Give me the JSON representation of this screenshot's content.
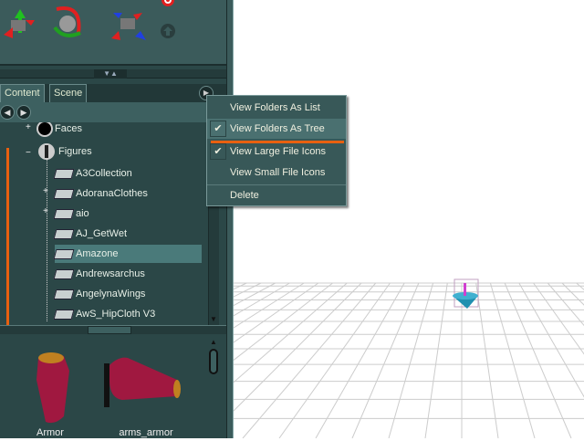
{
  "tabs": [
    {
      "label": "Content",
      "active": true
    },
    {
      "label": "Scene",
      "active": false
    }
  ],
  "tree": {
    "roots": [
      {
        "label": "Faces",
        "expander": "+"
      },
      {
        "label": "Figures",
        "expander": "−"
      }
    ],
    "folders": [
      {
        "label": "A3Collection",
        "expander": ""
      },
      {
        "label": "AdoranaClothes",
        "expander": "+"
      },
      {
        "label": "aio",
        "expander": "+"
      },
      {
        "label": "AJ_GetWet",
        "expander": ""
      },
      {
        "label": "Amazone",
        "expander": "",
        "selected": true
      },
      {
        "label": "Andrewsarchus",
        "expander": ""
      },
      {
        "label": "AngelynaWings",
        "expander": ""
      },
      {
        "label": "AwS_HipCloth V3",
        "expander": ""
      }
    ]
  },
  "thumbnails": [
    {
      "label": "Armor"
    },
    {
      "label": "arms_armor"
    }
  ],
  "menu": {
    "items": [
      {
        "label": "View Folders As List",
        "checked": false
      },
      {
        "label": "View Folders As Tree",
        "checked": true
      },
      {
        "label": "View Large File Icons",
        "checked": true
      },
      {
        "label": "View Small File Icons",
        "checked": false
      },
      {
        "label": "Delete",
        "checked": false
      }
    ],
    "check_glyph": "✔"
  },
  "icons": {
    "nav_back": "◀",
    "nav_fwd": "▶",
    "menu": "▶",
    "scroll_up": "▲",
    "scroll_down": "▼"
  },
  "colors": {
    "panel": "#2b4747",
    "accent": "#e86010",
    "selection": "#4a7a7a"
  }
}
